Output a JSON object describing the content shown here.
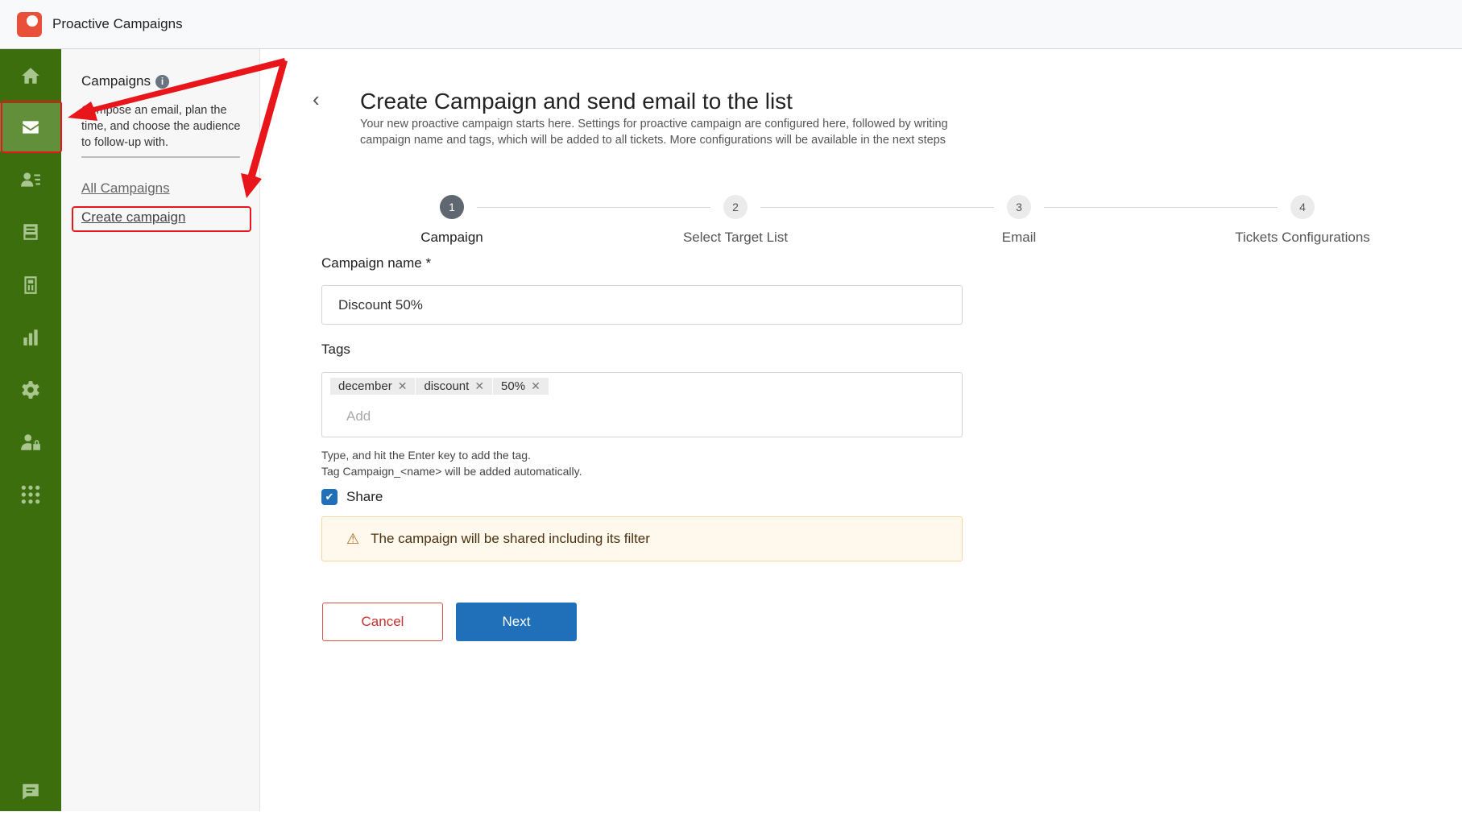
{
  "app": {
    "title": "Proactive Campaigns"
  },
  "rail": {
    "items": [
      {
        "icon": "home-icon"
      },
      {
        "icon": "mail-icon",
        "active": true
      },
      {
        "icon": "contacts-icon"
      },
      {
        "icon": "inbox-icon"
      },
      {
        "icon": "document-icon"
      },
      {
        "icon": "chart-icon"
      },
      {
        "icon": "gear-icon"
      },
      {
        "icon": "user-lock-icon"
      },
      {
        "icon": "apps-grid-icon"
      },
      {
        "icon": "chat-icon"
      }
    ]
  },
  "panel": {
    "title": "Campaigns",
    "desc": "Compose an email, plan the time, and choose the audience to follow-up with.",
    "links": [
      "All Campaigns",
      "Create campaign"
    ]
  },
  "page": {
    "title": "Create Campaign and send email to the list",
    "desc": "Your new proactive campaign starts here. Settings for proactive campaign are configured here, followed by writing campaign name and tags, which will be added to all tickets. More configurations will be available in the next steps"
  },
  "steps": [
    {
      "num": "1",
      "label": "Campaign",
      "active": true
    },
    {
      "num": "2",
      "label": "Select Target List"
    },
    {
      "num": "3",
      "label": "Email"
    },
    {
      "num": "4",
      "label": "Tickets Configurations"
    }
  ],
  "form": {
    "name_label": "Campaign name *",
    "name_value": "Discount 50%",
    "tags_label": "Tags",
    "tags": [
      "december",
      "discount",
      "50%"
    ],
    "tags_placeholder": "Add",
    "help1": "Type, and hit the Enter key to add the tag.",
    "help2": "Tag Campaign_<name> will be added automatically.",
    "share_label": "Share",
    "share_checked": true,
    "alert": "The campaign will be shared including its filter",
    "cancel": "Cancel",
    "next": "Next"
  },
  "colors": {
    "rail": "#3d6e0e",
    "primary": "#1f70b8",
    "annotation": "#e8161b"
  }
}
